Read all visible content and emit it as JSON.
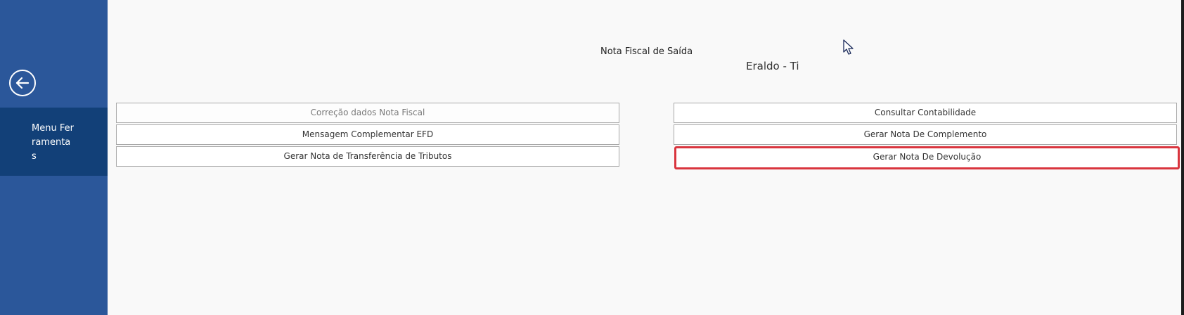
{
  "sidebar": {
    "back_icon": "arrow-left-circle-icon",
    "menu_label": "Menu Ferramentas"
  },
  "main": {
    "title": "Nota Fiscal de Saída",
    "user": "Eraldo - Ti",
    "left_buttons": [
      {
        "label": "Correção dados Nota Fiscal",
        "state": "disabled"
      },
      {
        "label": "Mensagem Complementar EFD"
      },
      {
        "label": "Gerar Nota de Transferência de Tributos"
      }
    ],
    "right_buttons": [
      {
        "label": "Consultar Contabilidade"
      },
      {
        "label": "Gerar Nota De Complemento"
      },
      {
        "label": "Gerar Nota De Devolução",
        "state": "highlighted"
      }
    ]
  },
  "colors": {
    "sidebar": "#2b579a",
    "sidebar_active": "#124078",
    "highlight": "#d9353e"
  }
}
